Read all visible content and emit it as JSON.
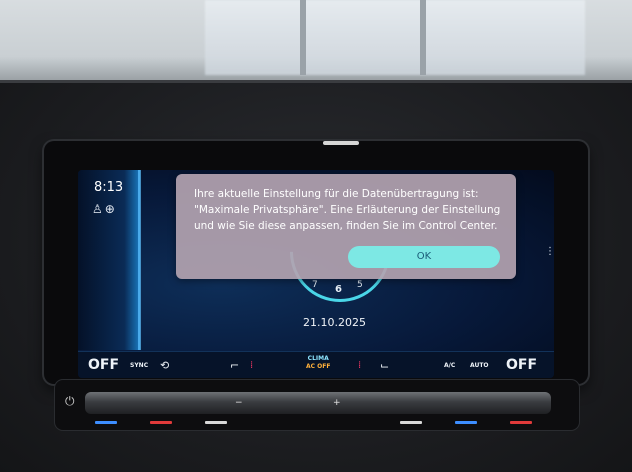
{
  "status": {
    "time": "8:13",
    "icons": [
      "person-icon",
      "globe-icon"
    ]
  },
  "dialog": {
    "message": "Ihre aktuelle Einstellung für die Datenübertragung ist: \"Maximale Privatsphäre\". Eine Erläuterung der Einstellung und wie Sie diese anpassen, finden Sie im Control Center.",
    "ok_label": "OK"
  },
  "dial": {
    "numbers": [
      "7",
      "6",
      "5"
    ]
  },
  "date": "21.10.2025",
  "climate": {
    "left_off": "OFF",
    "sync": "SYNC",
    "clima": "CLIMA",
    "ac_off": "AC OFF",
    "ac": "A/C",
    "auto": "AUTO",
    "right_off": "OFF"
  },
  "colors": {
    "accent": "#4ad6e8",
    "ok_button": "#7de8e4",
    "heater_red": "#e5355f"
  }
}
